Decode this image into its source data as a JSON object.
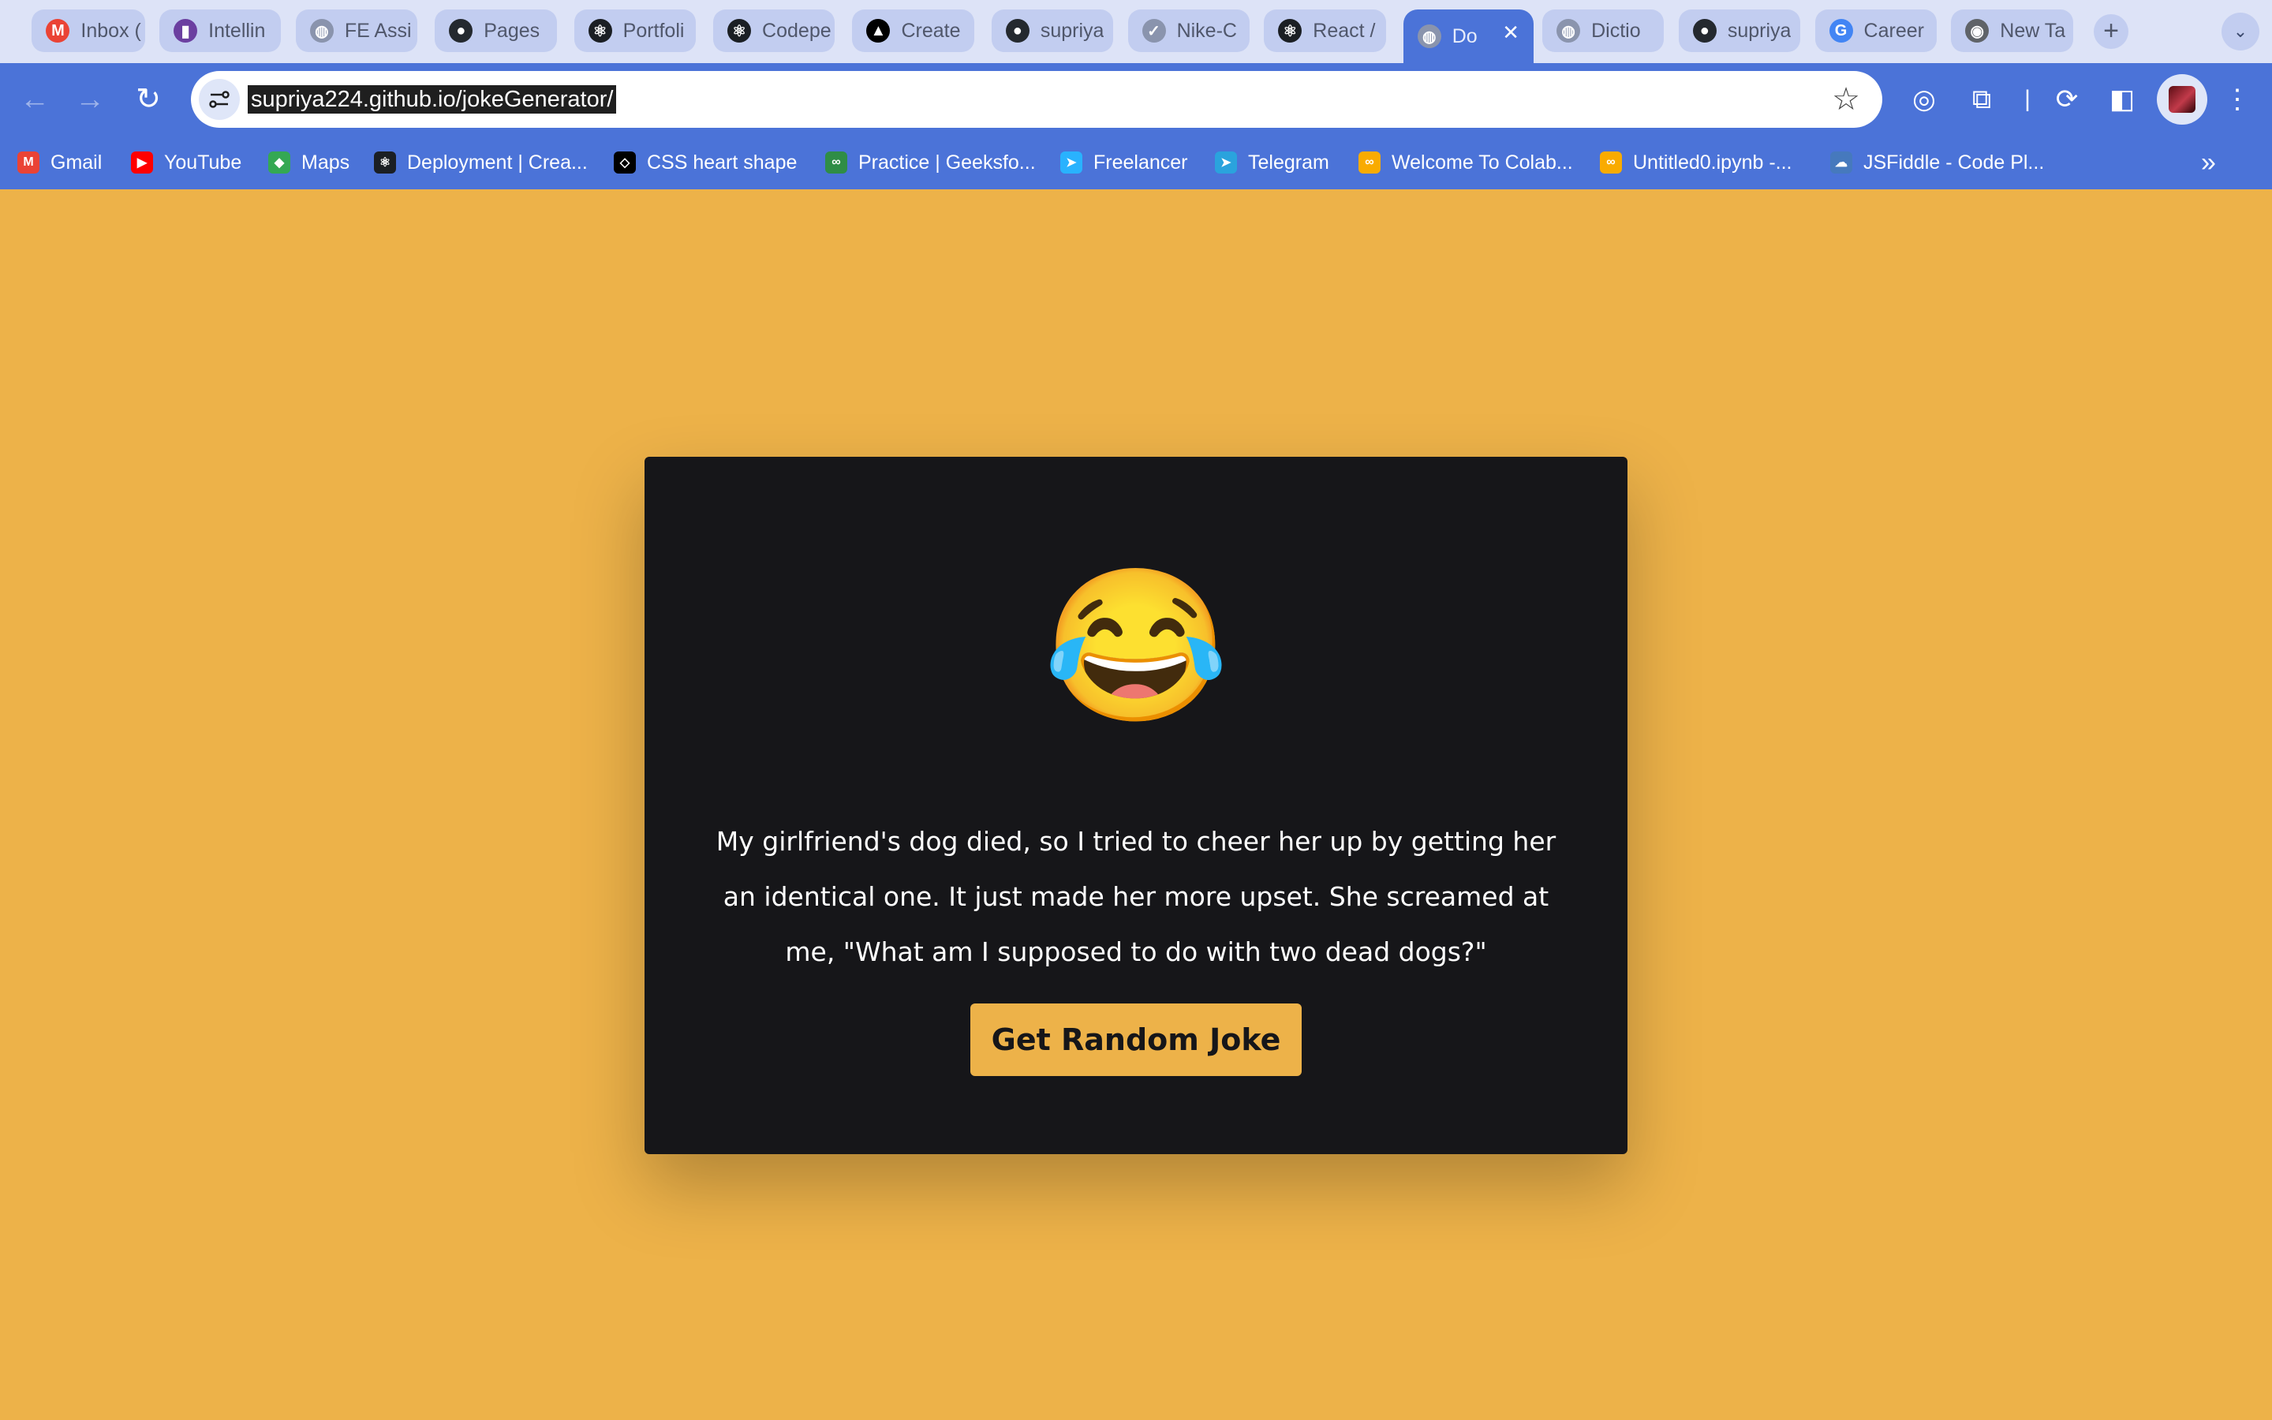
{
  "browser": {
    "tabs": [
      {
        "label": "Inbox (",
        "icon": "gmail-icon",
        "color": "#ea4335",
        "glyph": "M"
      },
      {
        "label": "Intellin",
        "icon": "intellin-icon",
        "color": "#6b3fa0",
        "glyph": "▮"
      },
      {
        "label": "FE Assi",
        "icon": "globe-icon",
        "color": "#8a94ad",
        "glyph": "◍"
      },
      {
        "label": "Pages",
        "icon": "github-icon",
        "color": "#24292f",
        "glyph": "●"
      },
      {
        "label": "Portfoli",
        "icon": "react-icon",
        "color": "#1b1f24",
        "glyph": "⚛"
      },
      {
        "label": "Codepe",
        "icon": "react-icon",
        "color": "#1b1f24",
        "glyph": "⚛"
      },
      {
        "label": "Create",
        "icon": "triangle-icon",
        "color": "#000000",
        "glyph": "▲"
      },
      {
        "label": "supriya",
        "icon": "github-icon",
        "color": "#24292f",
        "glyph": "●"
      },
      {
        "label": "Nike-C",
        "icon": "check-icon",
        "color": "#8a94ad",
        "glyph": "✓"
      },
      {
        "label": "React /",
        "icon": "react-icon",
        "color": "#1b1f24",
        "glyph": "⚛"
      },
      {
        "label": "Do",
        "icon": "globe-icon",
        "color": "#8a94ad",
        "glyph": "◍",
        "active": true
      },
      {
        "label": "Dictio",
        "icon": "globe-icon",
        "color": "#8a94ad",
        "glyph": "◍"
      },
      {
        "label": "supriya",
        "icon": "github-icon",
        "color": "#24292f",
        "glyph": "●"
      },
      {
        "label": "Career",
        "icon": "google-icon",
        "color": "#4285f4",
        "glyph": "G"
      },
      {
        "label": "New Ta",
        "icon": "chrome-icon",
        "color": "#5f6368",
        "glyph": "◉"
      }
    ],
    "new_tab": "+",
    "tab_menu": "⌄",
    "url": "supriya224.github.io/jokeGenerator/",
    "bookmarks": [
      {
        "label": "Gmail",
        "icon": "gmail-icon",
        "color": "#ea4335",
        "glyph": "M"
      },
      {
        "label": "YouTube",
        "icon": "youtube-icon",
        "color": "#ff0000",
        "glyph": "▶"
      },
      {
        "label": "Maps",
        "icon": "maps-icon",
        "color": "#34a853",
        "glyph": "◆"
      },
      {
        "label": "Deployment | Crea...",
        "icon": "react-icon",
        "color": "#1b1f24",
        "glyph": "⚛"
      },
      {
        "label": "CSS heart shape",
        "icon": "codepen-icon",
        "color": "#000000",
        "glyph": "◇"
      },
      {
        "label": "Practice | Geeksfo...",
        "icon": "geeks-icon",
        "color": "#2f8d46",
        "glyph": "∞"
      },
      {
        "label": "Freelancer",
        "icon": "freelancer-icon",
        "color": "#29b2fe",
        "glyph": "➤"
      },
      {
        "label": "Telegram",
        "icon": "telegram-icon",
        "color": "#2aa3dd",
        "glyph": "➤"
      },
      {
        "label": "Welcome To Colab...",
        "icon": "colab-icon",
        "color": "#f9ab00",
        "glyph": "∞"
      },
      {
        "label": "Untitled0.ipynb -...",
        "icon": "colab-icon",
        "color": "#f9ab00",
        "glyph": "∞"
      },
      {
        "label": "JSFiddle - Code Pl...",
        "icon": "jsfiddle-icon",
        "color": "#4679bd",
        "glyph": "☁"
      }
    ]
  },
  "page": {
    "emoji": "😂",
    "joke": "My girlfriend's dog died, so I tried to cheer her up by getting her an identical one. It just made her more upset. She screamed at me, \"What am I supposed to do with two dead dogs?\"",
    "button_label": "Get Random Joke",
    "background_color": "#edb249",
    "card_color": "#161619"
  }
}
